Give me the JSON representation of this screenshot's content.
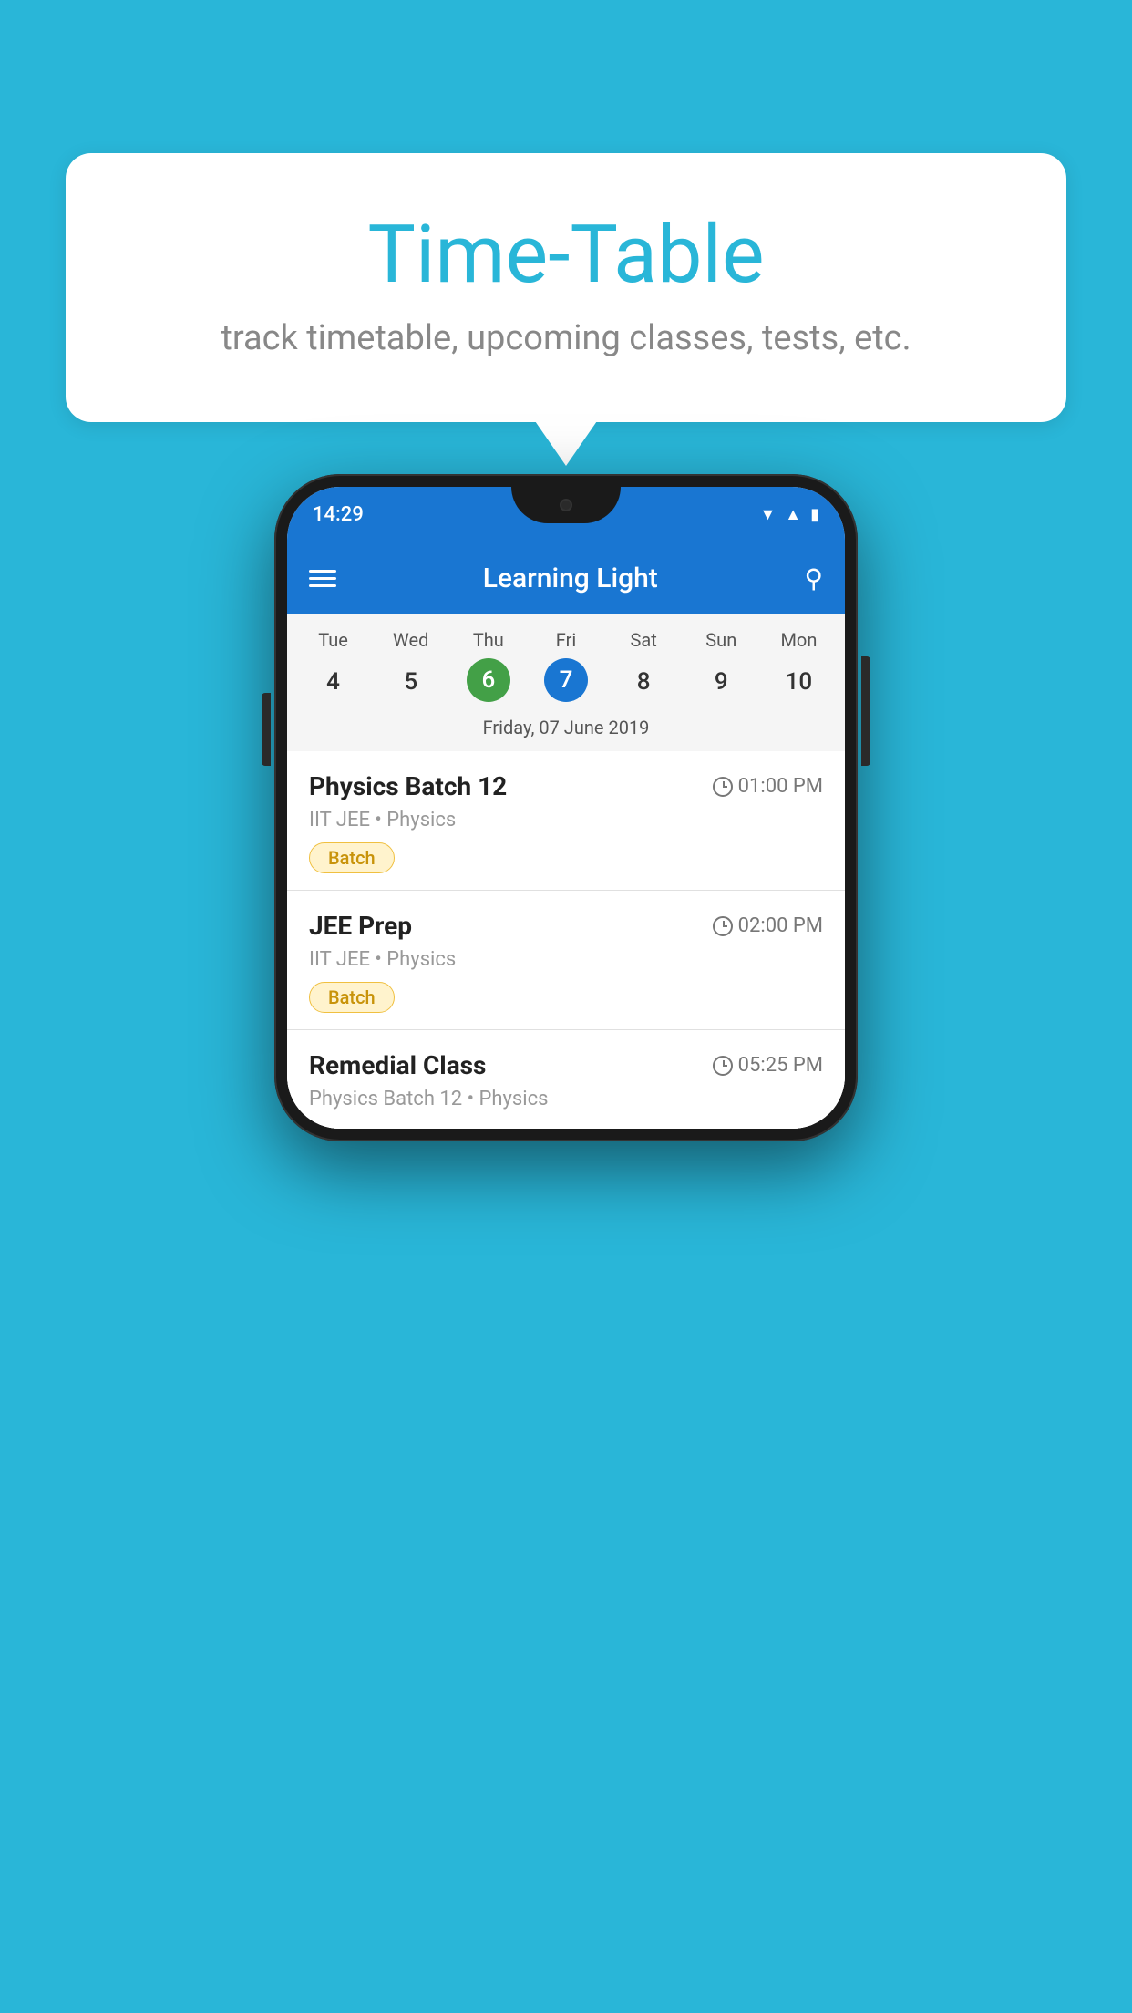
{
  "background_color": "#29b6d8",
  "bubble": {
    "title": "Time-Table",
    "subtitle": "track timetable, upcoming classes, tests, etc."
  },
  "phone": {
    "status_bar": {
      "time": "14:29"
    },
    "app_header": {
      "title": "Learning Light"
    },
    "calendar": {
      "day_labels": [
        "Tue",
        "Wed",
        "Thu",
        "Fri",
        "Sat",
        "Sun",
        "Mon"
      ],
      "day_numbers": [
        "4",
        "5",
        "6",
        "7",
        "8",
        "9",
        "10"
      ],
      "today_index": 2,
      "selected_index": 3,
      "selected_date_label": "Friday, 07 June 2019"
    },
    "schedule": [
      {
        "title": "Physics Batch 12",
        "time": "01:00 PM",
        "sub": "IIT JEE • Physics",
        "badge": "Batch"
      },
      {
        "title": "JEE Prep",
        "time": "02:00 PM",
        "sub": "IIT JEE • Physics",
        "badge": "Batch"
      },
      {
        "title": "Remedial Class",
        "time": "05:25 PM",
        "sub": "Physics Batch 12 • Physics",
        "badge": null
      }
    ]
  }
}
